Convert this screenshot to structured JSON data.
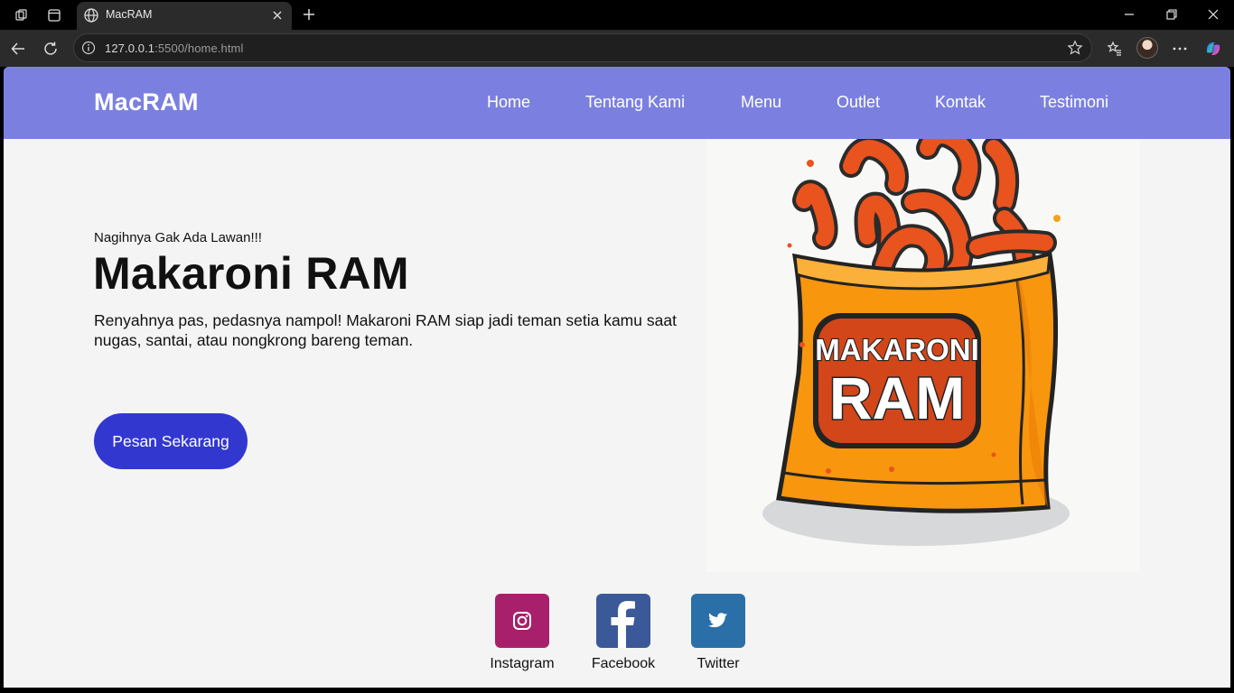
{
  "browser": {
    "tab_title": "MacRAM",
    "url_host": "127.0.0.1",
    "url_rest": ":5500/home.html"
  },
  "navbar": {
    "logo": "MacRAM",
    "links": [
      "Home",
      "Tentang Kami",
      "Menu",
      "Outlet",
      "Kontak",
      "Testimoni"
    ]
  },
  "hero": {
    "tagline": "Nagihnya Gak Ada Lawan!!!",
    "title": "Makaroni RAM",
    "description": "Renyahnya pas, pedasnya nampol! Makaroni RAM siap jadi teman setia kamu saat nugas, santai, atau nongkrong bareng teman.",
    "cta_label": "Pesan Sekarang",
    "image_text_line1": "MAKARONI",
    "image_text_line2": "RAM"
  },
  "socials": [
    {
      "label": "Instagram",
      "icon": "instagram-icon",
      "color": "#a8206b"
    },
    {
      "label": "Facebook",
      "icon": "facebook-icon",
      "color": "#3b5998"
    },
    {
      "label": "Twitter",
      "icon": "twitter-icon",
      "color": "#2a6fa8"
    }
  ],
  "colors": {
    "navbar": "#7b80e0",
    "cta": "#3238cf",
    "page_bg": "#f4f4f4"
  }
}
